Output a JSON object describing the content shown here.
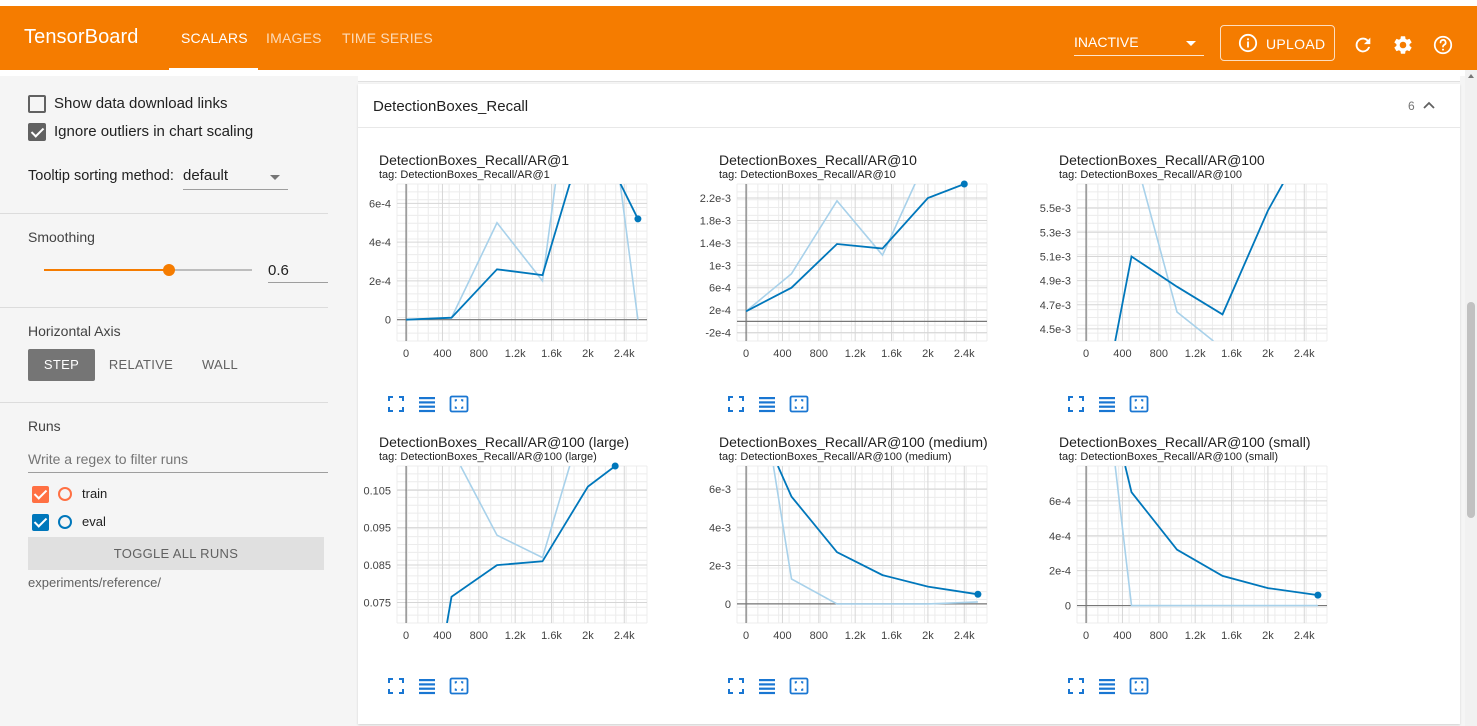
{
  "app": {
    "title": "TensorBoard",
    "accent": "#f57c00",
    "tabs": [
      {
        "label": "SCALARS",
        "active": true
      },
      {
        "label": "IMAGES",
        "active": false
      },
      {
        "label": "TIME SERIES",
        "active": false
      }
    ],
    "status_select": "INACTIVE",
    "upload_label": "UPLOAD",
    "icons": [
      "refresh-icon",
      "settings-gear-icon",
      "help-icon"
    ]
  },
  "sidebar": {
    "show_download_links": {
      "label": "Show data download links",
      "checked": false
    },
    "ignore_outliers": {
      "label": "Ignore outliers in chart scaling",
      "checked": true
    },
    "tooltip_sorting": {
      "label": "Tooltip sorting method:",
      "value": "default"
    },
    "smoothing": {
      "label": "Smoothing",
      "value": "0.6",
      "fraction": 0.6
    },
    "horizontal_axis": {
      "label": "Horizontal Axis",
      "options": [
        "STEP",
        "RELATIVE",
        "WALL"
      ],
      "selected": "STEP"
    },
    "runs": {
      "label": "Runs",
      "filter_placeholder": "Write a regex to filter runs",
      "items": [
        {
          "name": "train",
          "checked": true,
          "color": "#ff7043"
        },
        {
          "name": "eval",
          "checked": true,
          "color": "#0077bb"
        }
      ],
      "toggle_all_label": "TOGGLE ALL RUNS",
      "experiment_path": "experiments/reference/"
    }
  },
  "main": {
    "group": {
      "title": "DetectionBoxes_Recall",
      "count": "6",
      "expanded": true
    },
    "chart_icons": [
      "fullscreen-icon",
      "toggle-log-scale-icon",
      "fit-domain-icon"
    ]
  },
  "chart_data": [
    {
      "type": "line",
      "title": "DetectionBoxes_Recall/AR@1",
      "tag": "tag: DetectionBoxes_Recall/AR@1",
      "xticks": [
        "0",
        "400",
        "800",
        "1.2k",
        "1.6k",
        "2k",
        "2.4k"
      ],
      "yticks": [
        "0",
        "2e-4",
        "4e-4",
        "6e-4"
      ],
      "xlim": [
        -100,
        2650
      ],
      "ylim": [
        -0.00011,
        0.0007
      ],
      "series": [
        {
          "name": "eval",
          "smoothed": true,
          "x": [
            0,
            500,
            1000,
            1500,
            1800,
            2200,
            2550
          ],
          "y": [
            0,
            1e-05,
            0.00026,
            0.00023,
            0.0007,
            0.00085,
            0.00052
          ]
        },
        {
          "name": "eval",
          "smoothed": false,
          "x": [
            0,
            500,
            1000,
            1500,
            1700,
            2300,
            2550
          ],
          "y": [
            0,
            1e-05,
            0.0005,
            0.0002,
            0.0009,
            0.0009,
            0.0
          ]
        }
      ]
    },
    {
      "type": "line",
      "title": "DetectionBoxes_Recall/AR@10",
      "tag": "tag: DetectionBoxes_Recall/AR@10",
      "xticks": [
        "0",
        "400",
        "800",
        "1.2k",
        "1.6k",
        "2k",
        "2.4k"
      ],
      "yticks": [
        "-2e-4",
        "2e-4",
        "6e-4",
        "1e-3",
        "1.4e-3",
        "1.8e-3",
        "2.2e-3"
      ],
      "xlim": [
        -100,
        2650
      ],
      "ylim": [
        -0.00035,
        0.00245
      ],
      "series": [
        {
          "name": "eval",
          "smoothed": true,
          "x": [
            0,
            500,
            1000,
            1500,
            2000,
            2400
          ],
          "y": [
            0.00018,
            0.0006,
            0.00138,
            0.0013,
            0.0022,
            0.00245
          ]
        },
        {
          "name": "eval",
          "smoothed": false,
          "x": [
            0,
            500,
            1000,
            1500,
            1900
          ],
          "y": [
            0.00018,
            0.00085,
            0.00215,
            0.00118,
            0.0026
          ]
        }
      ]
    },
    {
      "type": "line",
      "title": "DetectionBoxes_Recall/AR@100",
      "tag": "tag: DetectionBoxes_Recall/AR@100",
      "xticks": [
        "0",
        "400",
        "800",
        "1.2k",
        "1.6k",
        "2k",
        "2.4k"
      ],
      "yticks": [
        "4.5e-3",
        "4.7e-3",
        "4.9e-3",
        "5.1e-3",
        "5.3e-3",
        "5.5e-3"
      ],
      "xlim": [
        -100,
        2650
      ],
      "ylim": [
        0.0044,
        0.0057
      ],
      "series": [
        {
          "name": "eval",
          "smoothed": true,
          "x": [
            320,
            500,
            1000,
            1500,
            2000,
            2200
          ],
          "y": [
            0.0044,
            0.0051,
            0.00485,
            0.00462,
            0.00548,
            0.00575
          ]
        },
        {
          "name": "eval",
          "smoothed": false,
          "x": [
            620,
            1000,
            1400
          ],
          "y": [
            0.0057,
            0.00464,
            0.0044
          ]
        }
      ]
    },
    {
      "type": "line",
      "title": "DetectionBoxes_Recall/AR@100 (large)",
      "tag": "tag: DetectionBoxes_Recall/AR@100 (large)",
      "xticks": [
        "0",
        "400",
        "800",
        "1.2k",
        "1.6k",
        "2k",
        "2.4k"
      ],
      "yticks": [
        "0.075",
        "0.085",
        "0.095",
        "0.105"
      ],
      "xlim": [
        -100,
        2650
      ],
      "ylim": [
        0.0695,
        0.1115
      ],
      "series": [
        {
          "name": "eval",
          "smoothed": true,
          "x": [
            450,
            500,
            1000,
            1500,
            2000,
            2300
          ],
          "y": [
            0.0695,
            0.0765,
            0.085,
            0.086,
            0.106,
            0.1115
          ]
        },
        {
          "name": "eval",
          "smoothed": false,
          "x": [
            600,
            1000,
            1500,
            1800
          ],
          "y": [
            0.1115,
            0.093,
            0.087,
            0.1115
          ]
        }
      ]
    },
    {
      "type": "line",
      "title": "DetectionBoxes_Recall/AR@100 (medium)",
      "tag": "tag: DetectionBoxes_Recall/AR@100 (medium)",
      "xticks": [
        "0",
        "400",
        "800",
        "1.2k",
        "1.6k",
        "2k",
        "2.4k"
      ],
      "yticks": [
        "0",
        "2e-3",
        "4e-3",
        "6e-3"
      ],
      "xlim": [
        -100,
        2650
      ],
      "ylim": [
        -0.001,
        0.0072
      ],
      "series": [
        {
          "name": "eval",
          "smoothed": true,
          "x": [
            350,
            500,
            1000,
            1500,
            2000,
            2550
          ],
          "y": [
            0.0072,
            0.0056,
            0.0027,
            0.0015,
            0.0009,
            0.0005
          ]
        },
        {
          "name": "eval",
          "smoothed": false,
          "x": [
            300,
            500,
            1000,
            1500,
            2000,
            2550
          ],
          "y": [
            0.0072,
            0.0013,
            0.0,
            0.0,
            0.0,
            0.0001
          ]
        }
      ]
    },
    {
      "type": "line",
      "title": "DetectionBoxes_Recall/AR@100 (small)",
      "tag": "tag: DetectionBoxes_Recall/AR@100 (small)",
      "xticks": [
        "0",
        "400",
        "800",
        "1.2k",
        "1.6k",
        "2k",
        "2.4k"
      ],
      "yticks": [
        "0",
        "2e-4",
        "4e-4",
        "6e-4"
      ],
      "xlim": [
        -100,
        2650
      ],
      "ylim": [
        -0.0001,
        0.0008
      ],
      "series": [
        {
          "name": "eval",
          "smoothed": true,
          "x": [
            430,
            500,
            1000,
            1500,
            2000,
            2550
          ],
          "y": [
            0.0008,
            0.00065,
            0.00032,
            0.00017,
            0.0001,
            6e-05
          ]
        },
        {
          "name": "eval",
          "smoothed": false,
          "x": [
            320,
            500,
            1000,
            1500,
            2000,
            2550
          ],
          "y": [
            0.0008,
            0.0,
            0.0,
            0.0,
            0.0,
            0.0
          ]
        }
      ]
    }
  ]
}
